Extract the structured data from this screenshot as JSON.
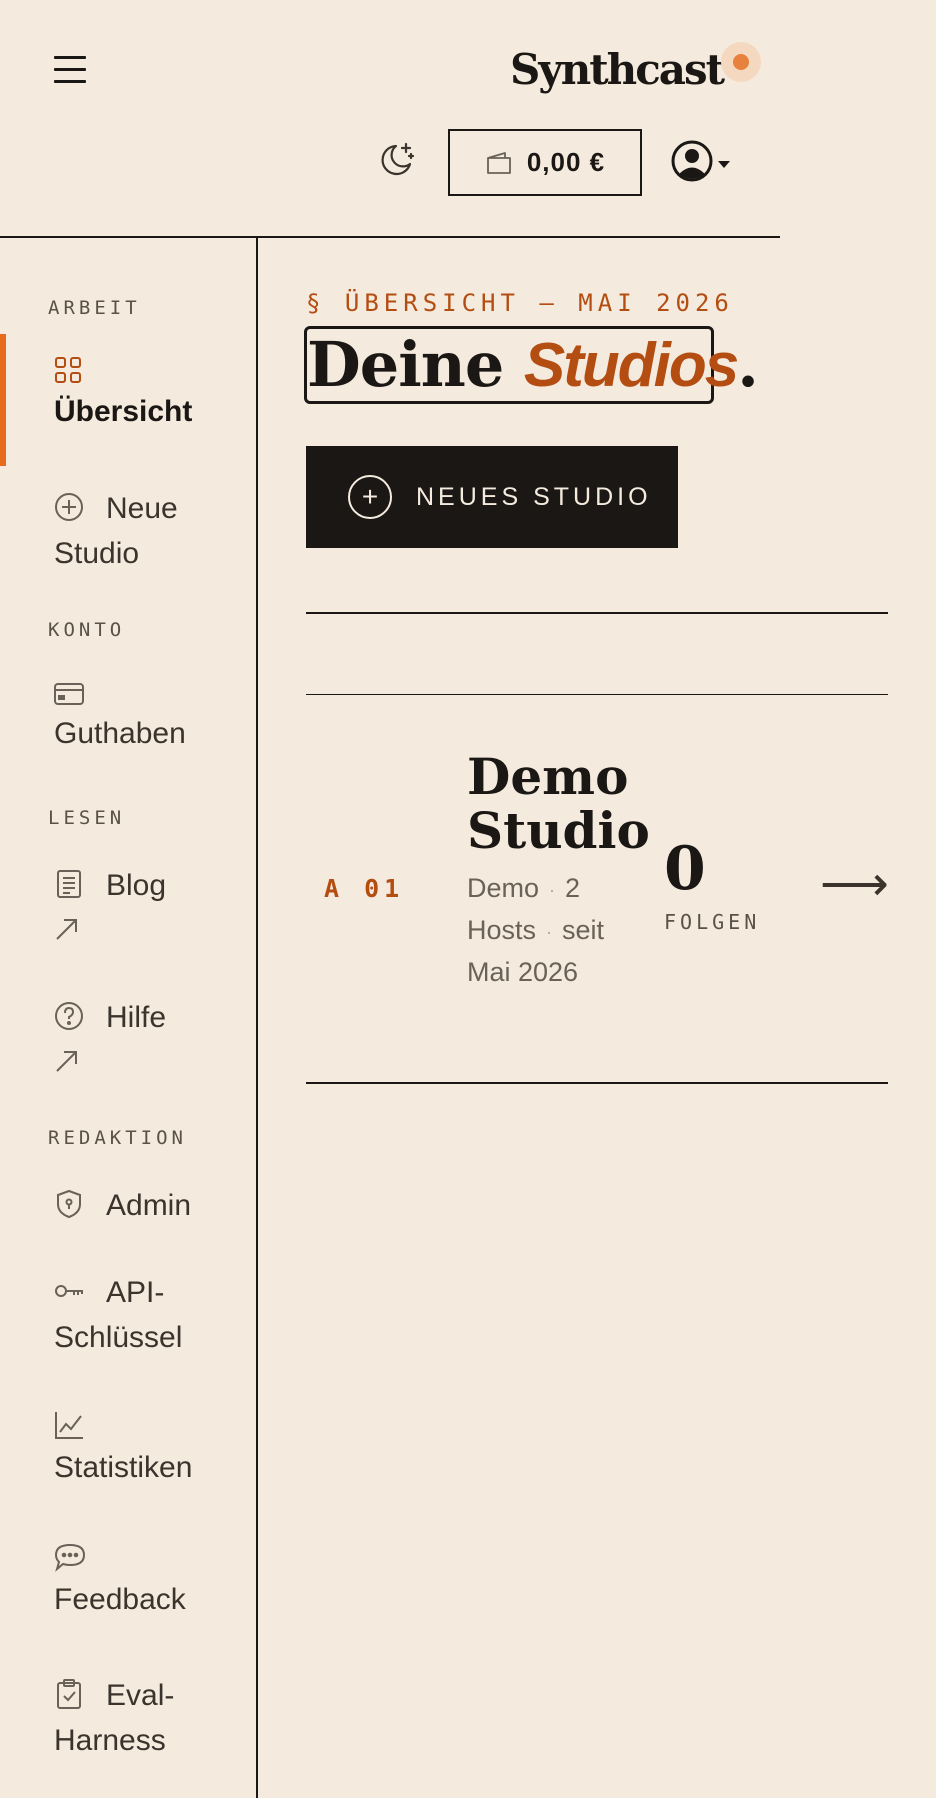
{
  "header": {
    "brand": "Synthcast",
    "wallet_amount": "0,00 €"
  },
  "sidebar": {
    "sections": [
      {
        "label": "ARBEIT"
      },
      {
        "label": "KONTO"
      },
      {
        "label": "LESEN"
      },
      {
        "label": "REDAKTION"
      }
    ],
    "items": [
      {
        "label": "Übersicht",
        "icon": "grid-icon",
        "active": true
      },
      {
        "label": "Neue Studio",
        "icon": "plus-circle-icon"
      },
      {
        "label": "Guthaben",
        "icon": "credit-card-icon"
      },
      {
        "label": "Blog",
        "icon": "document-icon",
        "external": true
      },
      {
        "label": "Hilfe",
        "icon": "help-circle-icon",
        "external": true
      },
      {
        "label": "Admin",
        "icon": "shield-icon"
      },
      {
        "label": "API-Schlüssel",
        "icon": "key-icon"
      },
      {
        "label": "Statistiken",
        "icon": "chart-icon"
      },
      {
        "label": "Feedback",
        "icon": "chat-bubble-icon"
      },
      {
        "label": "Eval-Harness",
        "icon": "clipboard-check-icon"
      }
    ]
  },
  "main": {
    "eyebrow": "§ ÜBERSICHT — MAI 2026",
    "title_plain": "Deine",
    "title_accent": "Studios",
    "title_period": ".",
    "new_studio_label": "NEUES STUDIO",
    "studios": [
      {
        "index": "A 01",
        "name": "Demo Studio",
        "meta_owner": "Demo",
        "meta_hosts": "2 Hosts",
        "meta_since": "seit Mai 2026",
        "followers": "0",
        "followers_label": "FOLGEN"
      }
    ]
  },
  "colors": {
    "background": "#f4ebde",
    "ink": "#1a1714",
    "accent": "#b44d12",
    "active_bar": "#e86a1c",
    "brand_dot": "#e8803e"
  }
}
